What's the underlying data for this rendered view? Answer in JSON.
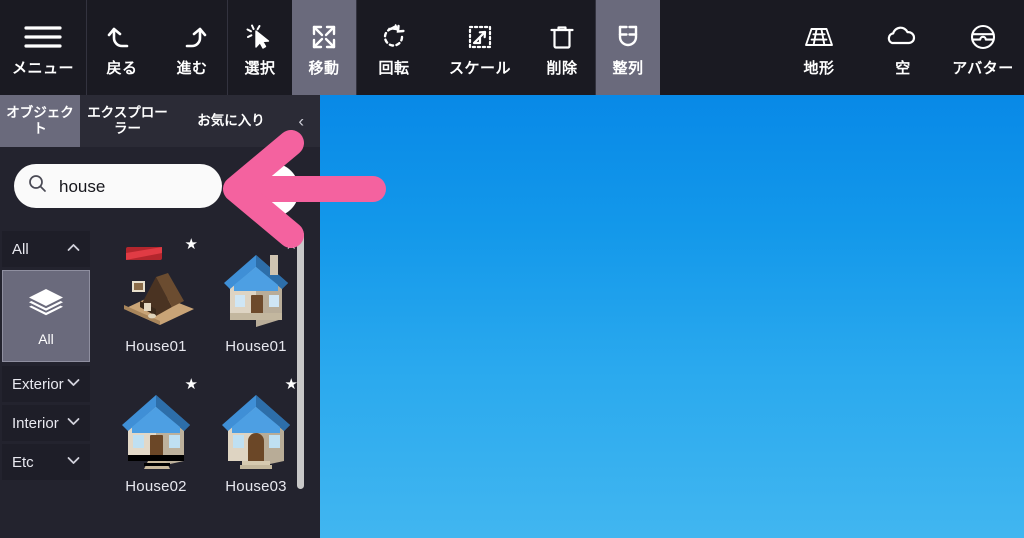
{
  "app": {
    "theme_bg": "#1a1a22",
    "panel_bg": "#23232e",
    "accent_highlight": "#6a6a7c",
    "sky_top": "#0889e7",
    "sky_bottom": "#41b6f0",
    "annotation_color": "#f4629f"
  },
  "toolbar": {
    "items": [
      {
        "label": "メニュー",
        "icon": "hamburger-menu-icon",
        "active": false
      },
      {
        "label": "戻る",
        "icon": "undo-arrow-icon",
        "active": false
      },
      {
        "label": "進む",
        "icon": "redo-arrow-icon",
        "active": false
      },
      {
        "label": "選択",
        "icon": "select-cursor-icon",
        "active": false
      },
      {
        "label": "移動",
        "icon": "move-arrows-icon",
        "active": true
      },
      {
        "label": "回転",
        "icon": "rotate-icon",
        "active": false
      },
      {
        "label": "スケール",
        "icon": "scale-icon",
        "active": false
      },
      {
        "label": "削除",
        "icon": "trash-can-icon",
        "active": false
      },
      {
        "label": "整列",
        "icon": "magnet-snap-icon",
        "active": true
      },
      {
        "label": "地形",
        "icon": "terrain-grid-icon",
        "active": false
      },
      {
        "label": "空",
        "icon": "cloud-icon",
        "active": false
      },
      {
        "label": "アバター",
        "icon": "avatar-vr-icon",
        "active": false
      }
    ]
  },
  "panel": {
    "tabs": [
      {
        "label": "オブジェクト",
        "active": true
      },
      {
        "label": "エクスプローラー",
        "active": false
      },
      {
        "label": "お気に入り",
        "active": false
      }
    ],
    "collapse_chevron": "‹",
    "search": {
      "value": "house",
      "placeholder": "",
      "icon": "search-icon"
    },
    "categories": [
      {
        "label": "All",
        "expanded": true,
        "chevron": "⌃"
      },
      {
        "label": "Exterior",
        "expanded": false,
        "chevron": "⌄"
      },
      {
        "label": "Interior",
        "expanded": false,
        "chevron": "⌄"
      },
      {
        "label": "Etc",
        "expanded": false,
        "chevron": "⌄"
      }
    ],
    "selected_category": {
      "label": "All",
      "icon": "layers-stack-icon"
    },
    "items": [
      {
        "label": "House01",
        "favorite": true,
        "thumb": "house-ruin-brown-thumb"
      },
      {
        "label": "House01",
        "favorite": true,
        "thumb": "house-blue-roof-thumb"
      },
      {
        "label": "House02",
        "favorite": true,
        "thumb": "house-blue-roof-porch-thumb"
      },
      {
        "label": "House03",
        "favorite": true,
        "thumb": "house-blue-roof-stone-thumb"
      }
    ],
    "star_glyph": "★",
    "scrollbar": {
      "visible": true
    }
  },
  "annotations": {
    "arrow": {
      "name": "pink-left-arrow",
      "direction": "left",
      "points_at": "search-input"
    },
    "cursor_dot": {
      "name": "cursor-highlight-dot"
    }
  }
}
